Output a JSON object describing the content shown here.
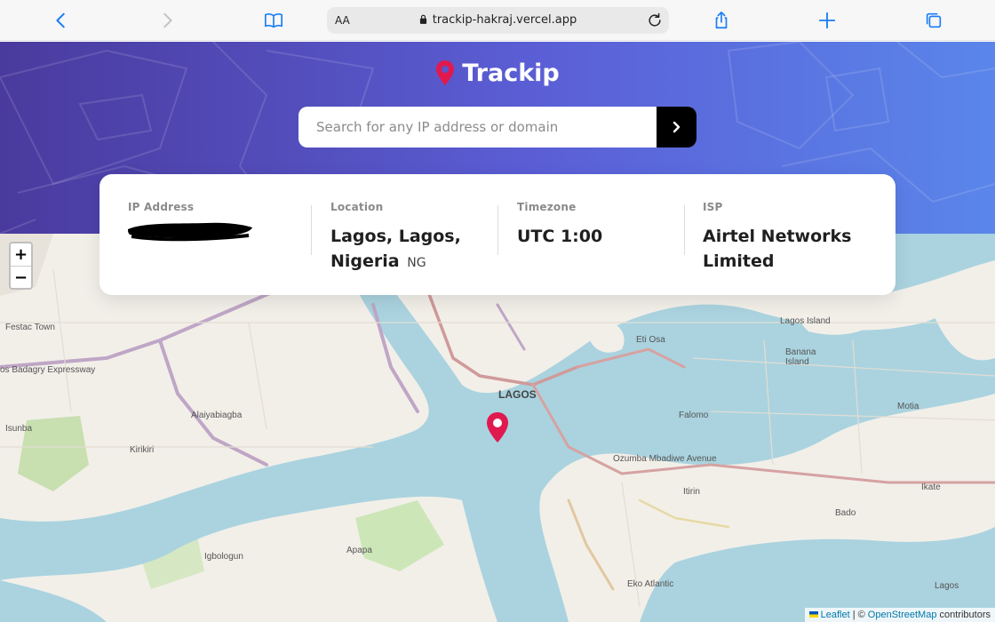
{
  "browser": {
    "reader_label": "AA",
    "url": "trackip-hakraj.vercel.app"
  },
  "header": {
    "brand": "Trackip",
    "search_placeholder": "Search for any IP address or domain"
  },
  "info": {
    "ip": {
      "label": "IP Address",
      "value": ""
    },
    "location": {
      "label": "Location",
      "value": "Lagos, Lagos, Nigeria",
      "country_code": "NG"
    },
    "timezone": {
      "label": "Timezone",
      "value": "UTC 1:00"
    },
    "isp": {
      "label": "ISP",
      "value": "Airtel Networks Limited"
    }
  },
  "map": {
    "zoom_in": "+",
    "zoom_out": "−",
    "city_label": "LAGOS",
    "labels": {
      "festac": "Festac Town",
      "badagry": "os Badagry Expressway",
      "alaiyabiagba": "Alaiyabiagba",
      "isunba": "Isunba",
      "kirikiri": "Kirikiri",
      "igbologun": "Igbologun",
      "apapa": "Apapa",
      "eti_osa": "Eti Osa",
      "falomo": "Falomo",
      "banana_island": "Banana Island",
      "lagos_island": "Lagos Island",
      "motia": "Motia",
      "ikate": "Ikate",
      "badore": "Bado",
      "itirin": "Itirin",
      "eko_atlantic": "Eko Atlantic",
      "ozumba": "Ozumba Mbadiwe Avenue",
      "lagos_bottom": "Lagos"
    },
    "attribution": {
      "leaflet": "Leaflet",
      "separator": "| ©",
      "osm": "OpenStreetMap",
      "suffix": "contributors"
    }
  },
  "colors": {
    "hero_start": "#4a3a9e",
    "hero_end": "#5a86ea",
    "pin": "#e0194f",
    "water": "#aad3df"
  }
}
